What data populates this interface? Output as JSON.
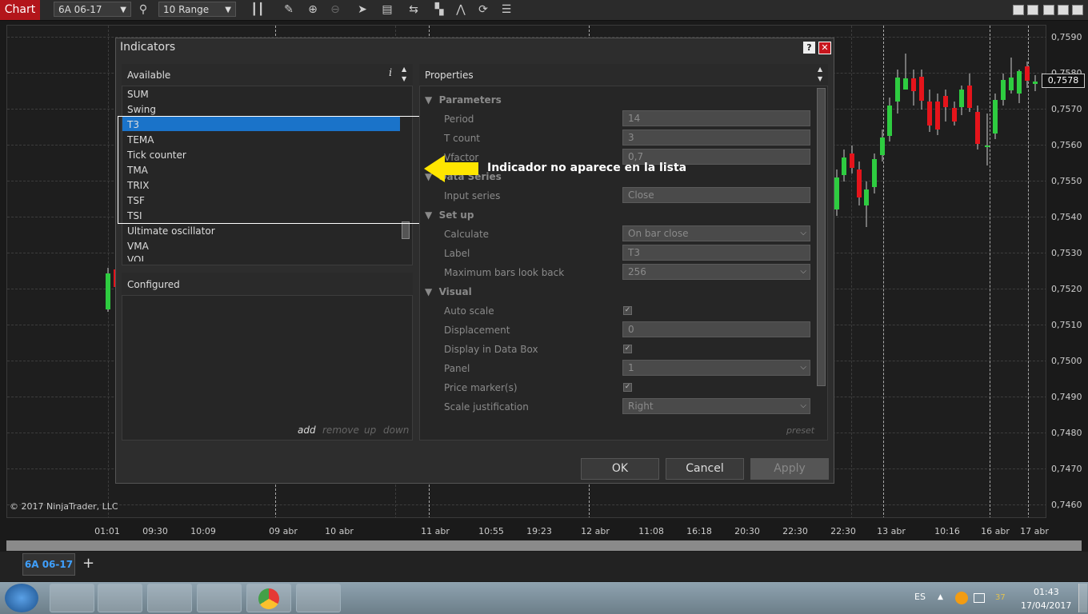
{
  "toolbar": {
    "chart_label": "Chart",
    "instrument": "6A 06-17",
    "bar_type": "10 Range"
  },
  "chart": {
    "y_labels": [
      "0,7590",
      "0,7580",
      "0,7570",
      "0,7560",
      "0,7550",
      "0,7540",
      "0,7530",
      "0,7520",
      "0,7510",
      "0,7500",
      "0,7490",
      "0,7480",
      "0,7470",
      "0,7460"
    ],
    "x_labels": [
      "01:01",
      "09:30",
      "10:09",
      "09 abr",
      "10 abr",
      "11 abr",
      "10:55",
      "19:23",
      "12 abr",
      "11:08",
      "16:18",
      "20:30",
      "22:30",
      "22:30",
      "13 abr",
      "10:16",
      "16 abr",
      "17 abr"
    ],
    "current_price": "0,7578",
    "copyright": "© 2017 NinjaTrader, LLC",
    "colors": {
      "up": "#2ecc40",
      "down": "#e5141b"
    }
  },
  "tabs": {
    "active": "6A 06-17",
    "add": "+"
  },
  "dialog": {
    "title": "Indicators",
    "help": "?",
    "close": "✕",
    "available": {
      "header": "Available",
      "info": "i",
      "items": [
        "SUM",
        "Swing",
        "T3",
        "TEMA",
        "Tick counter",
        "TMA",
        "TRIX",
        "TSF",
        "TSI",
        "Ultimate oscillator",
        "VMA",
        "VOL"
      ],
      "selected": "T3"
    },
    "configured": {
      "header": "Configured",
      "actions": [
        "add",
        "remove",
        "up",
        "down"
      ]
    },
    "annotation": "Indicador no aparece en la lista",
    "properties": {
      "header": "Properties",
      "categories": {
        "parameters": "Parameters",
        "data_series": "Data Series",
        "setup": "Set up",
        "visual": "Visual"
      },
      "period_label": "Period",
      "period": "14",
      "tcount_label": "T count",
      "tcount": "3",
      "vfactor_label": "Vfactor",
      "vfactor": "0,7",
      "input_series_label": "Input series",
      "input_series": "Close",
      "calculate_label": "Calculate",
      "calculate": "On bar close",
      "label_label": "Label",
      "label": "T3",
      "max_bars_label": "Maximum bars look back",
      "max_bars": "256",
      "auto_scale_label": "Auto scale",
      "displacement_label": "Displacement",
      "displacement": "0",
      "display_databox_label": "Display in Data Box",
      "panel_label": "Panel",
      "panel": "1",
      "price_marker_label": "Price marker(s)",
      "scale_just_label": "Scale justification",
      "scale_just": "Right",
      "preset": "preset"
    },
    "buttons": {
      "ok": "OK",
      "cancel": "Cancel",
      "apply": "Apply"
    }
  },
  "taskbar": {
    "lang": "ES",
    "time": "01:43",
    "date": "17/04/2017",
    "counter": "37"
  }
}
